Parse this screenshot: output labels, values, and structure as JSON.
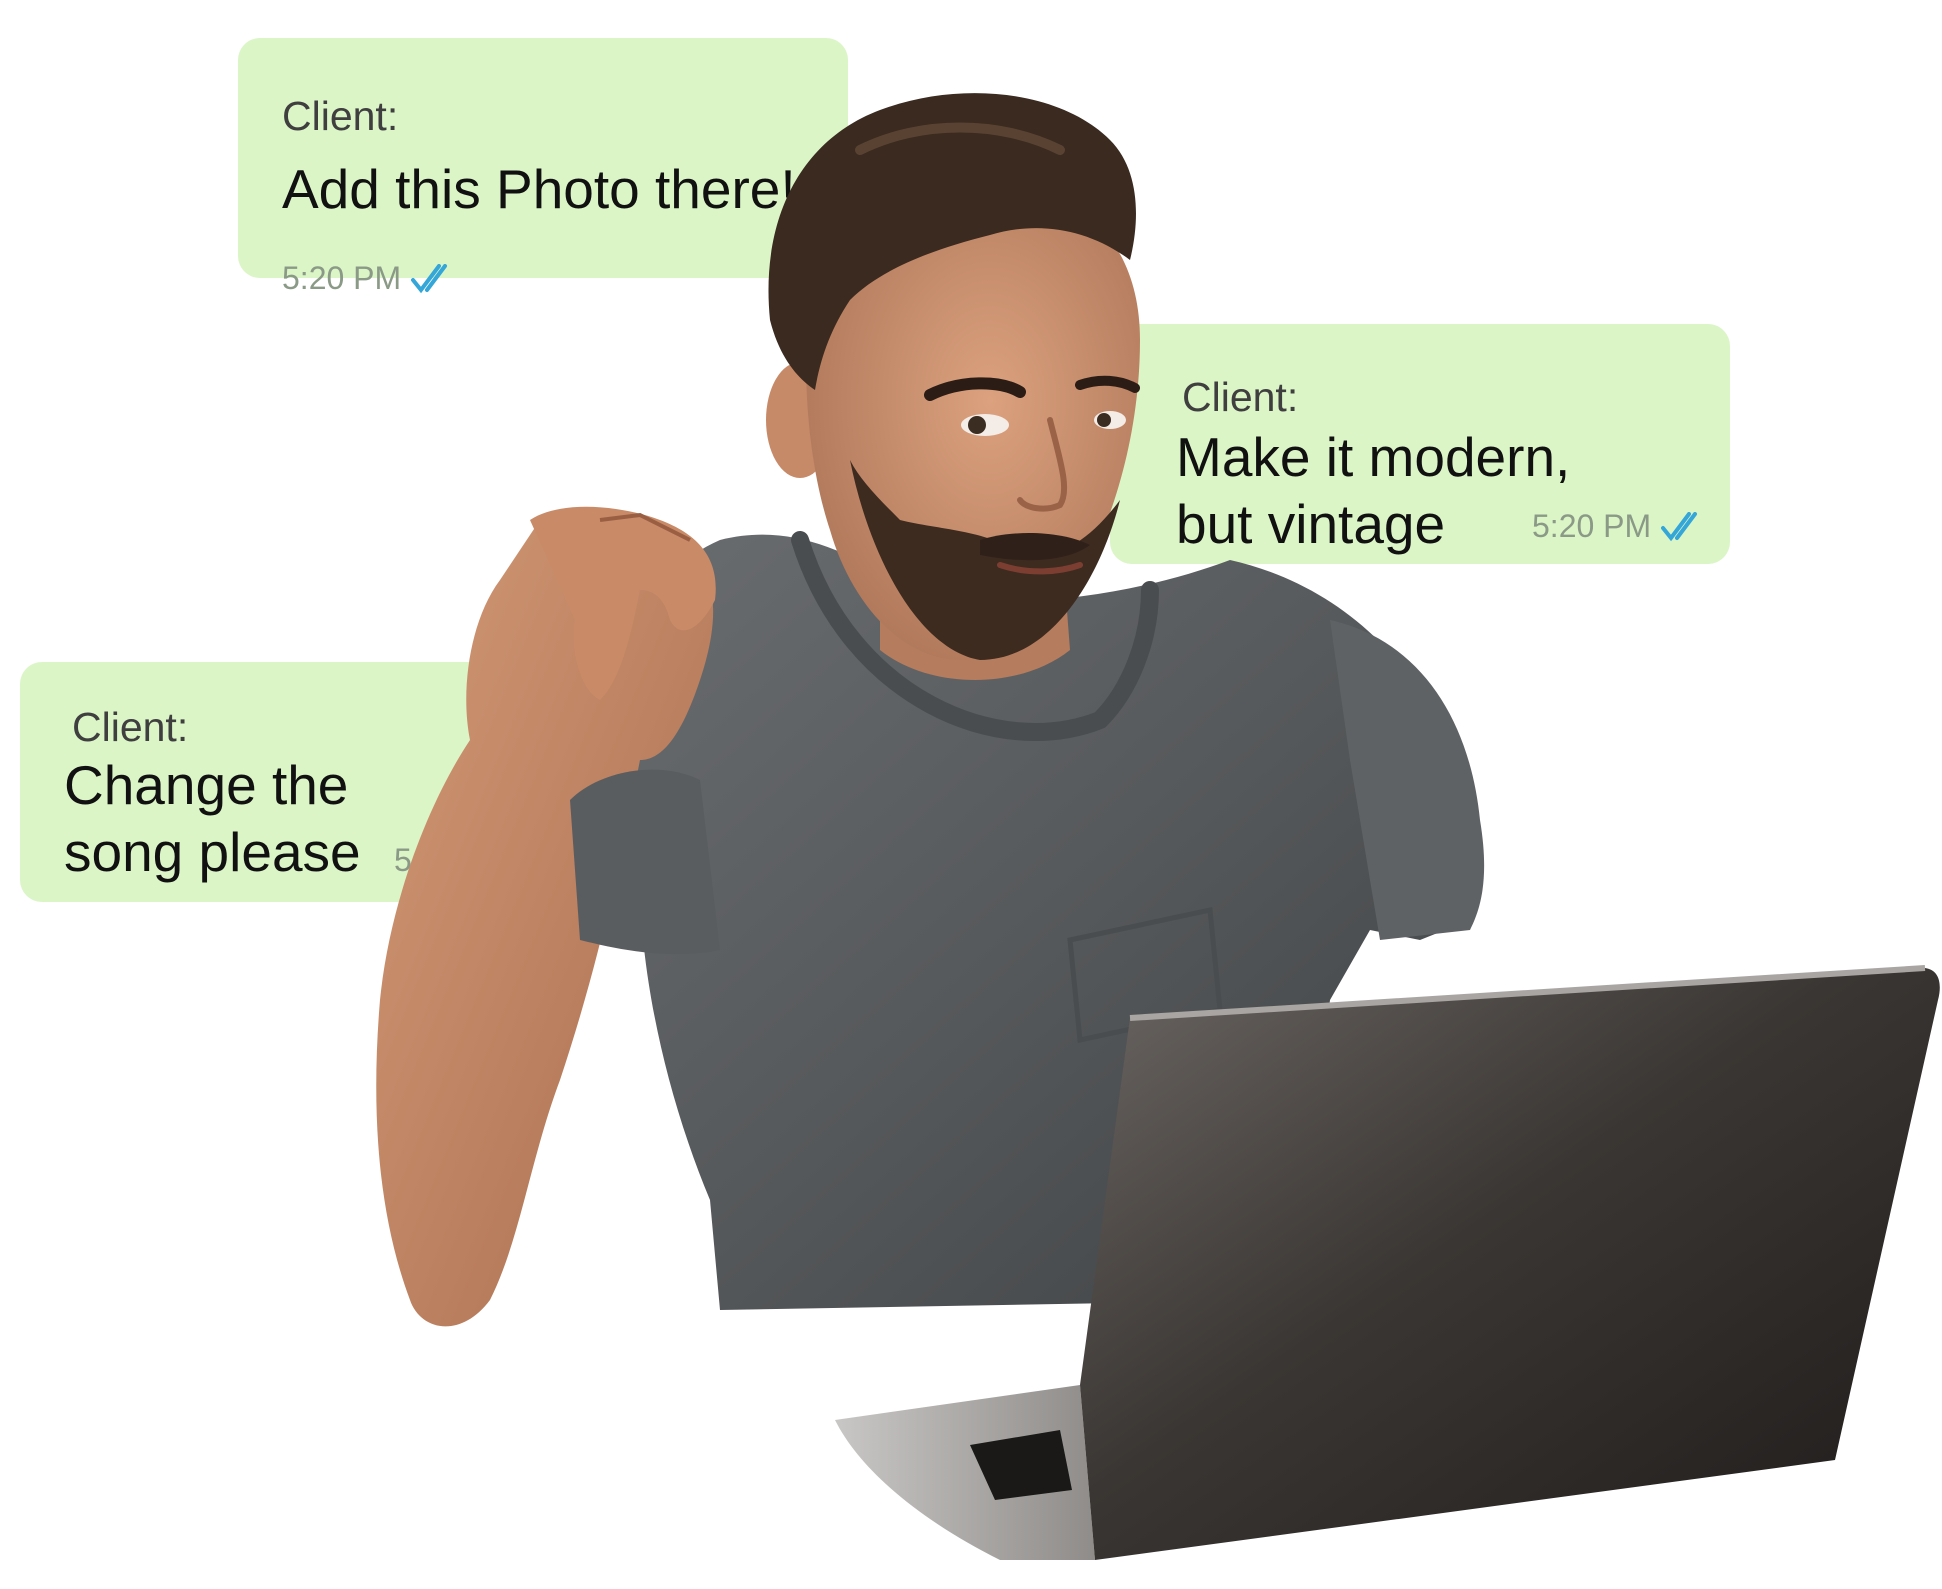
{
  "messages": [
    {
      "sender": "Client:",
      "text": "Add this Photo there!",
      "time": "5:20 PM",
      "status_icon": "double-check-icon"
    },
    {
      "sender": "Client:",
      "text": "Make it modern,\nbut vintage",
      "time": "5:20 PM",
      "status_icon": "double-check-icon"
    },
    {
      "sender": "Client:",
      "text": "Change the\nsong please",
      "time": "5:25",
      "status_icon": ""
    }
  ],
  "colors": {
    "bubble": "#dbf5c7",
    "tick": "#34a6d8",
    "shirt": "#55585a",
    "skin": "#c08563",
    "hair": "#3a2a20",
    "laptop": "#3b3735"
  }
}
